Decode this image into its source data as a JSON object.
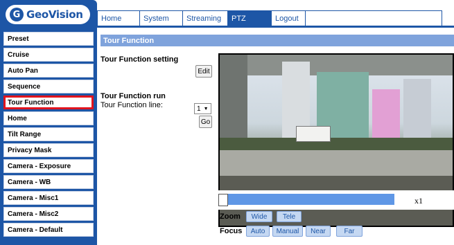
{
  "brand": {
    "logo_text": "GeoVision",
    "logo_mark": "G"
  },
  "nav": {
    "tabs": [
      {
        "label": "Home",
        "active": false
      },
      {
        "label": "System",
        "active": false
      },
      {
        "label": "Streaming",
        "active": false
      },
      {
        "label": "PTZ",
        "active": true
      },
      {
        "label": "Logout",
        "active": false
      }
    ]
  },
  "sidebar": {
    "items": [
      {
        "label": "Preset"
      },
      {
        "label": "Cruise"
      },
      {
        "label": "Auto Pan"
      },
      {
        "label": "Sequence"
      },
      {
        "label": "Tour Function",
        "selected": true
      },
      {
        "label": "Home"
      },
      {
        "label": "Tilt Range"
      },
      {
        "label": "Privacy Mask"
      },
      {
        "label": "Camera - Exposure"
      },
      {
        "label": "Camera - WB"
      },
      {
        "label": "Camera - Misc1"
      },
      {
        "label": "Camera - Misc2"
      },
      {
        "label": "Camera - Default"
      }
    ]
  },
  "main": {
    "section_title": "Tour Function",
    "setting_heading": "Tour Function setting",
    "edit_label": "Edit",
    "run_heading": "Tour Function run",
    "line_label": "Tour Function line:",
    "line_value": "1",
    "go_label": "Go"
  },
  "controls": {
    "zoom_level": "x1",
    "zoom_position": 0.0,
    "zoom_label": "Zoom",
    "wide_label": "Wide",
    "tele_label": "Tele",
    "focus_label": "Focus",
    "auto_label": "Auto",
    "manual_label": "Manual",
    "near_label": "Near",
    "far_label": "Far"
  },
  "colors": {
    "brand_blue": "#1d56a6",
    "header_blue": "#7fa3dc",
    "zoom_bar": "#5f97e6",
    "selected_outline": "#e0141e"
  }
}
